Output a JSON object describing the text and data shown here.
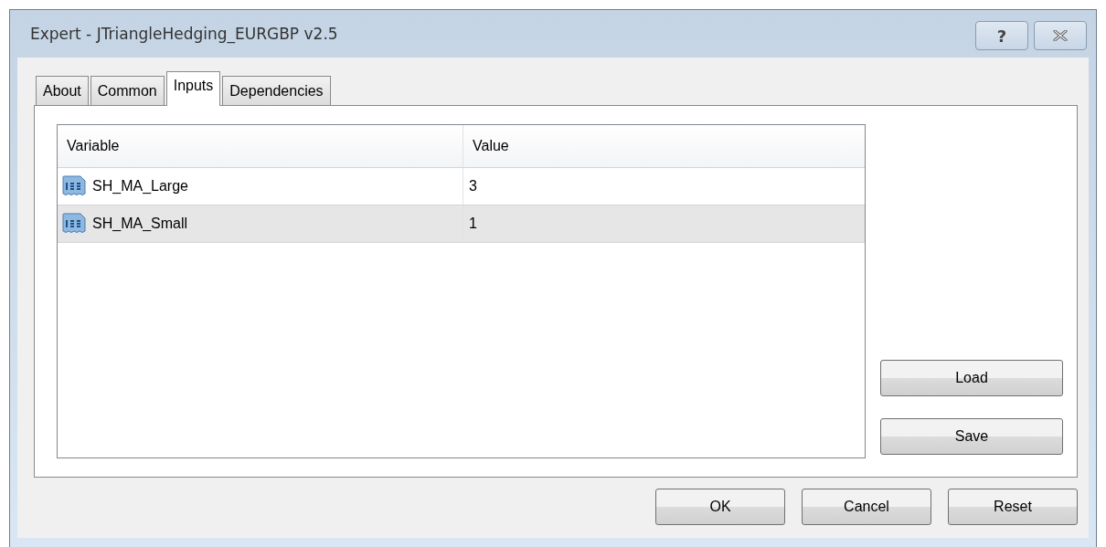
{
  "window": {
    "title": "Expert - JTriangleHedging_EURGBP v2.5",
    "help_button": "?"
  },
  "tabs": [
    {
      "label": "About",
      "selected": false
    },
    {
      "label": "Common",
      "selected": false
    },
    {
      "label": "Inputs",
      "selected": true
    },
    {
      "label": "Dependencies",
      "selected": false
    }
  ],
  "table": {
    "columns": [
      "Variable",
      "Value"
    ],
    "rows": [
      {
        "variable": "SH_MA_Large",
        "value": "3",
        "selected": false
      },
      {
        "variable": "SH_MA_Small",
        "value": "1",
        "selected": true
      }
    ]
  },
  "side_buttons": [
    "Load",
    "Save"
  ],
  "buttons": [
    "OK",
    "Cancel",
    "Reset"
  ]
}
